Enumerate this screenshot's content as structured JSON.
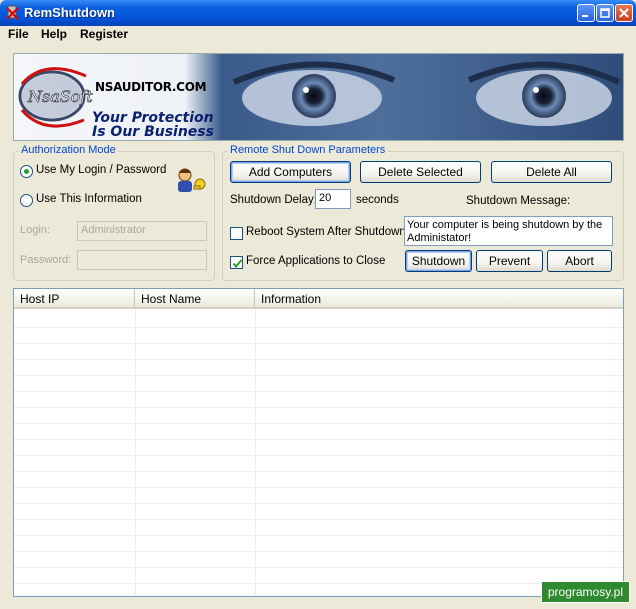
{
  "window": {
    "title": "RemShutdown"
  },
  "menu": [
    "File",
    "Help",
    "Register"
  ],
  "banner": {
    "brand": "NSAUDITOR.COM",
    "logo": "NsaSoft",
    "tagline1": "Your Protection",
    "tagline2": "Is Our Business"
  },
  "auth": {
    "legend": "Authorization Mode",
    "use_my_login": "Use My Login / Password",
    "use_this_info": "Use This Information",
    "login_label": "Login:",
    "login_value": "Administrator",
    "password_label": "Password:",
    "password_value": "",
    "selected": "use_my_login"
  },
  "remote": {
    "legend": "Remote Shut Down Parameters",
    "add_computers": "Add Computers",
    "delete_selected": "Delete Selected",
    "delete_all": "Delete All",
    "delay_label": "Shutdown Delay:",
    "delay_value": "20",
    "delay_unit": "seconds",
    "message_label": "Shutdown Message:",
    "message_value": "Your computer is being shutdown by the Administator!",
    "reboot_label": "Reboot System After Shutdown",
    "reboot_checked": false,
    "force_label": "Force Applications to Close",
    "force_checked": true,
    "shutdown_btn": "Shutdown",
    "prevent_btn": "Prevent",
    "abort_btn": "Abort"
  },
  "table": {
    "columns": [
      "Host IP",
      "Host Name",
      "Information"
    ],
    "rows": []
  },
  "watermark": "programosy.pl",
  "colors": {
    "titlebar": "#0454d8",
    "legend": "#0046d5",
    "check": "#21a121",
    "window_bg": "#ece9d8"
  }
}
